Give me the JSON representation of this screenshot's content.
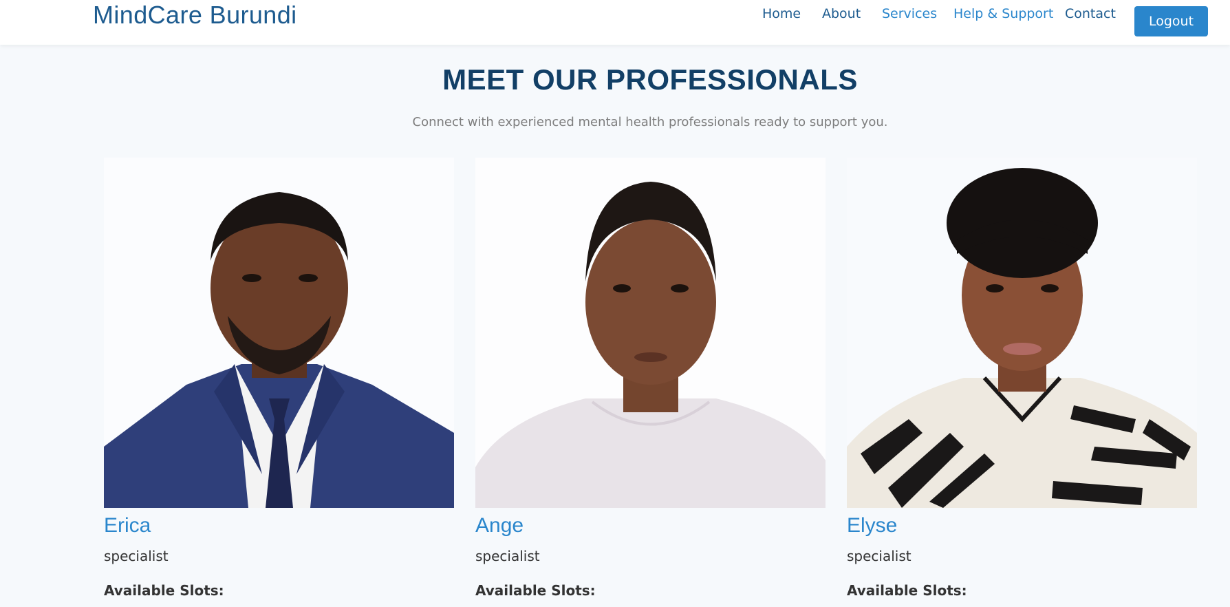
{
  "header": {
    "brand": "MindCare Burundi",
    "nav": [
      "Home",
      "About",
      "Services",
      "Help & Support",
      "Contact"
    ],
    "logout_label": "Logout"
  },
  "section": {
    "title": "MEET OUR PROFESSIONALS",
    "subtitle": "Connect with experienced mental health professionals ready to support you."
  },
  "professionals": [
    {
      "name": "Erica",
      "role": "specialist",
      "slots_label": "Available Slots:",
      "photo": "portrait-man-suit"
    },
    {
      "name": "Ange",
      "role": "specialist",
      "slots_label": "Available Slots:",
      "photo": "portrait-woman-white-shirt"
    },
    {
      "name": "Elyse",
      "role": "specialist",
      "slots_label": "Available Slots:",
      "photo": "portrait-woman-patterned-shirt"
    }
  ],
  "colors": {
    "brand": "#1d5b8f",
    "accent": "#2a86cc",
    "heading": "#123f66",
    "background": "#f6f9fc"
  }
}
